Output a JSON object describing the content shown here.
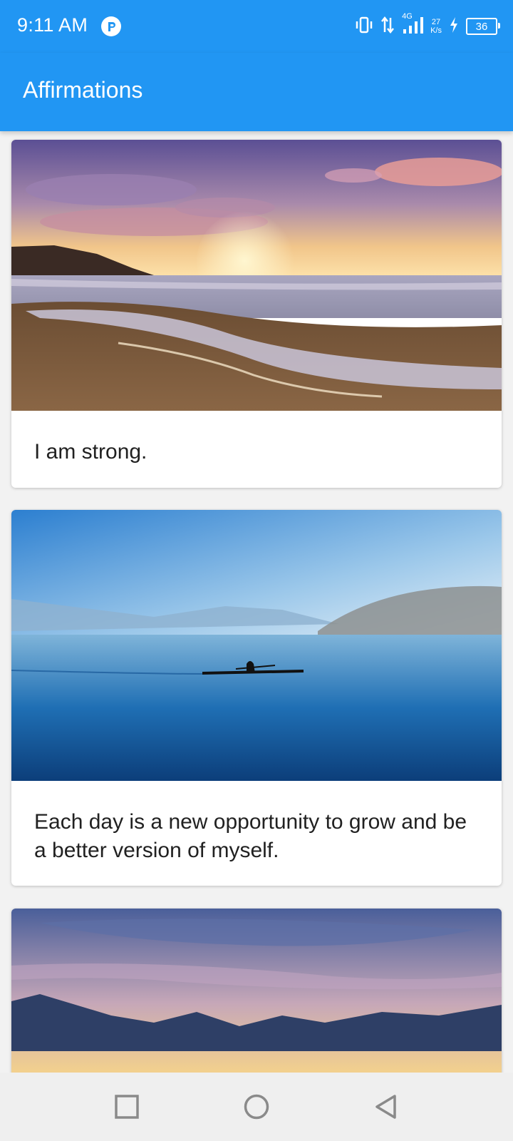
{
  "status_bar": {
    "time": "9:11 AM",
    "network": "4G",
    "speed_value": "27",
    "speed_unit": "K/s",
    "battery": "36",
    "icons": [
      "app-p-icon",
      "vibrate-icon",
      "data-transfer-icon",
      "signal-icon",
      "charging-icon",
      "battery-icon"
    ]
  },
  "app_bar": {
    "title": "Affirmations"
  },
  "cards": [
    {
      "text": "I am strong.",
      "image": "sunset-beach-photo"
    },
    {
      "text": "Each day is a new opportunity to grow and be a better version of myself.",
      "image": "lake-kayak-photo"
    },
    {
      "text": "",
      "image": "mountain-sunset-clouds-photo"
    }
  ],
  "nav_bar": {
    "icons": [
      "recents-square-icon",
      "home-circle-icon",
      "back-triangle-icon"
    ]
  },
  "colors": {
    "primary": "#2196f3",
    "card_background": "#ffffff",
    "feed_background": "#f2f2f2",
    "text_primary": "#212121",
    "nav_background": "#efefef",
    "nav_icon": "#8a8a8a"
  }
}
